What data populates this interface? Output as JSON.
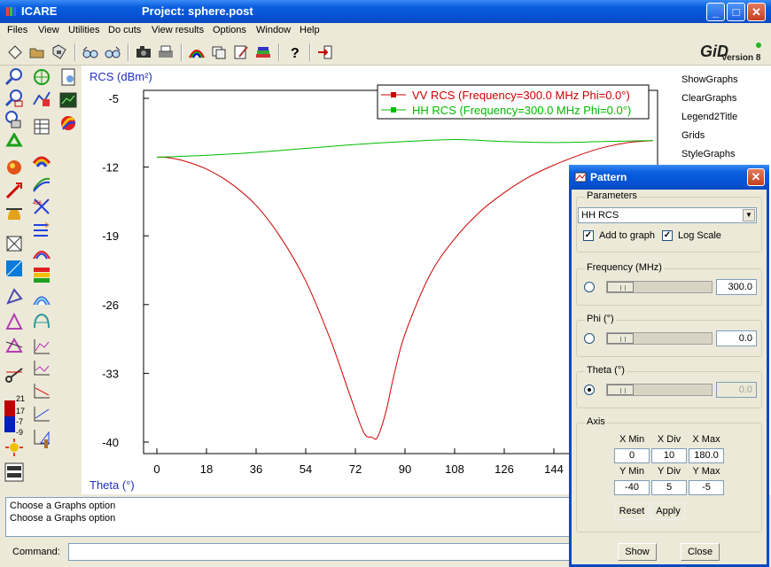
{
  "window": {
    "app_name": "ICARE",
    "project_title": "Project: sphere.post",
    "minimize": "_",
    "maximize": "□",
    "close": "✕"
  },
  "menubar": [
    "Files",
    "View",
    "Utilities",
    "Do cuts",
    "View results",
    "Options",
    "Window",
    "Help"
  ],
  "logo": {
    "gid": "GiD",
    "version": "Version 8"
  },
  "right_panel": [
    "ShowGraphs",
    "ClearGraphs",
    "Legend2Title",
    "Grids",
    "StyleGraphs"
  ],
  "messages": [
    "Choose a Graphs option",
    "Choose a Graphs option"
  ],
  "command_label": "Command:",
  "color_scale_labels": [
    "21",
    "17",
    "-7",
    "-9"
  ],
  "chart_data": {
    "type": "line",
    "ylabel": "RCS (dBm²)",
    "xlabel": "Theta (°)",
    "x_ticks": [
      0,
      18,
      36,
      54,
      72,
      90,
      108,
      126,
      144
    ],
    "y_ticks": [
      -5,
      -12,
      -19,
      -26,
      -33,
      -40
    ],
    "xlim": [
      0,
      180
    ],
    "ylim": [
      -40,
      -5
    ],
    "series": [
      {
        "name": "VV RCS (Frequency=300.0 MHz Phi=0.0°)",
        "color": "#cc0000",
        "x": [
          0,
          3,
          9,
          18,
          27,
          36,
          45,
          54,
          63,
          70,
          75,
          78,
          80,
          83,
          86,
          90,
          99,
          108,
          117,
          126,
          135,
          144,
          153,
          162,
          171,
          180
        ],
        "y": [
          -11.0,
          -11.0,
          -11.3,
          -12.2,
          -13.7,
          -15.9,
          -19.2,
          -23.6,
          -29.6,
          -35.2,
          -39.0,
          -39.5,
          -39.5,
          -37.0,
          -33.2,
          -29.0,
          -23.0,
          -19.3,
          -16.6,
          -14.6,
          -13.0,
          -11.8,
          -10.8,
          -10.0,
          -9.5,
          -9.3
        ]
      },
      {
        "name": "HH RCS (Frequency=300.0 MHz Phi=0.0°)",
        "color": "#00bb00",
        "x": [
          0,
          9,
          18,
          36,
          54,
          72,
          90,
          108,
          126,
          144,
          162,
          180
        ],
        "y": [
          -11.0,
          -10.9,
          -10.8,
          -10.5,
          -10.1,
          -9.7,
          -9.4,
          -9.2,
          -9.4,
          -9.5,
          -9.4,
          -9.3
        ]
      }
    ],
    "grid": false,
    "legend_position": "top-right"
  },
  "dialog": {
    "title": "Pattern",
    "close": "✕",
    "parameters_label": "Parameters",
    "parameter_value": "HH RCS",
    "add_to_graph": "Add to graph",
    "log_scale": "Log Scale",
    "frequency_label": "Frequency (MHz)",
    "frequency_value": "300.0",
    "phi_label": "Phi (°)",
    "phi_value": "0.0",
    "theta_label": "Theta (°)",
    "theta_value": "0.0",
    "axis_label": "Axis",
    "axis_headers": [
      "X Min",
      "X Div",
      "X Max",
      "Y Min",
      "Y Div",
      "Y Max"
    ],
    "axis_values": [
      "0",
      "10",
      "180.0",
      "-40",
      "5",
      "-5"
    ],
    "reset": "Reset",
    "apply": "Apply",
    "show": "Show",
    "close_button": "Close"
  }
}
